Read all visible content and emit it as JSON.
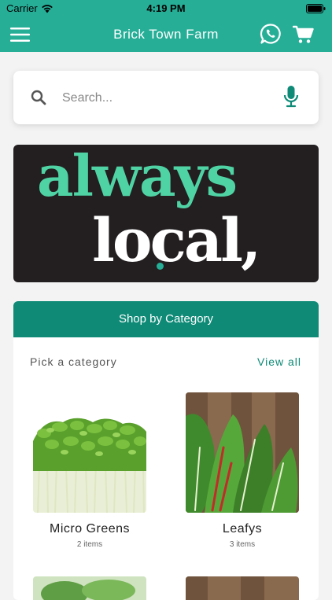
{
  "status_bar": {
    "carrier": "Carrier",
    "time": "4:19 PM"
  },
  "nav": {
    "title": "Brick Town Farm",
    "menu_icon": "hamburger-icon",
    "whatsapp_icon": "whatsapp-icon",
    "cart_icon": "cart-icon"
  },
  "search": {
    "placeholder": "Search...",
    "value": "",
    "search_icon": "search-icon",
    "mic_icon": "microphone-icon"
  },
  "banner": {
    "line1": "always",
    "line2": "local,",
    "active_slide": 1,
    "slide_count": 1
  },
  "categories": {
    "header": "Shop by Category",
    "subheading": "Pick a category",
    "view_all": "View all",
    "items": [
      {
        "name": "Micro Greens",
        "count": "2 items"
      },
      {
        "name": "Leafys",
        "count": "3 items"
      }
    ]
  },
  "colors": {
    "primary": "#26ae97",
    "header_dark": "#0e8a77",
    "banner_bg": "#231f20",
    "banner_accent": "#4fd3a5"
  }
}
